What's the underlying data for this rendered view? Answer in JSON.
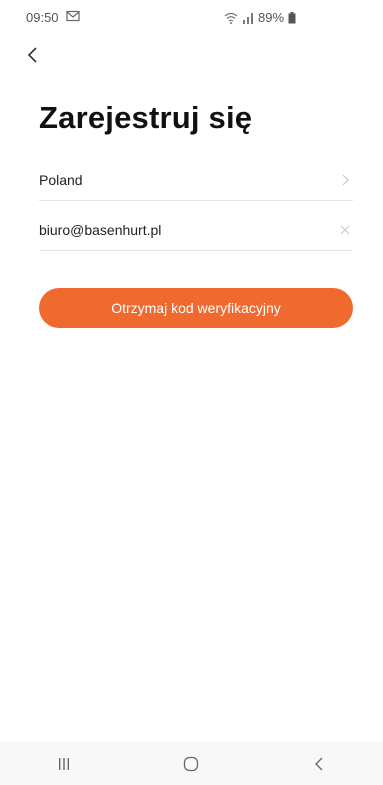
{
  "status_bar": {
    "time": "09:50",
    "mail_glyph": "M",
    "battery_text": "89%",
    "icons": [
      "mail-icon",
      "wifi-icon",
      "signal-icon",
      "battery-icon"
    ]
  },
  "header": {
    "back_icon": "chevron-left-icon"
  },
  "page": {
    "title": "Zarejestruj się"
  },
  "form": {
    "country_value": "Poland",
    "country_icon": "chevron-right-icon",
    "email_value": "biuro@basenhurt.pl",
    "email_clear_icon": "close-icon",
    "submit_label": "Otrzymaj kod weryfikacyjny"
  },
  "nav_bar": {
    "items": [
      "recent-apps-icon",
      "home-icon",
      "back-icon"
    ]
  },
  "colors": {
    "accent": "#f06a30",
    "title": "#111111",
    "divider": "#e4e4e4",
    "background": "#ffffff"
  }
}
